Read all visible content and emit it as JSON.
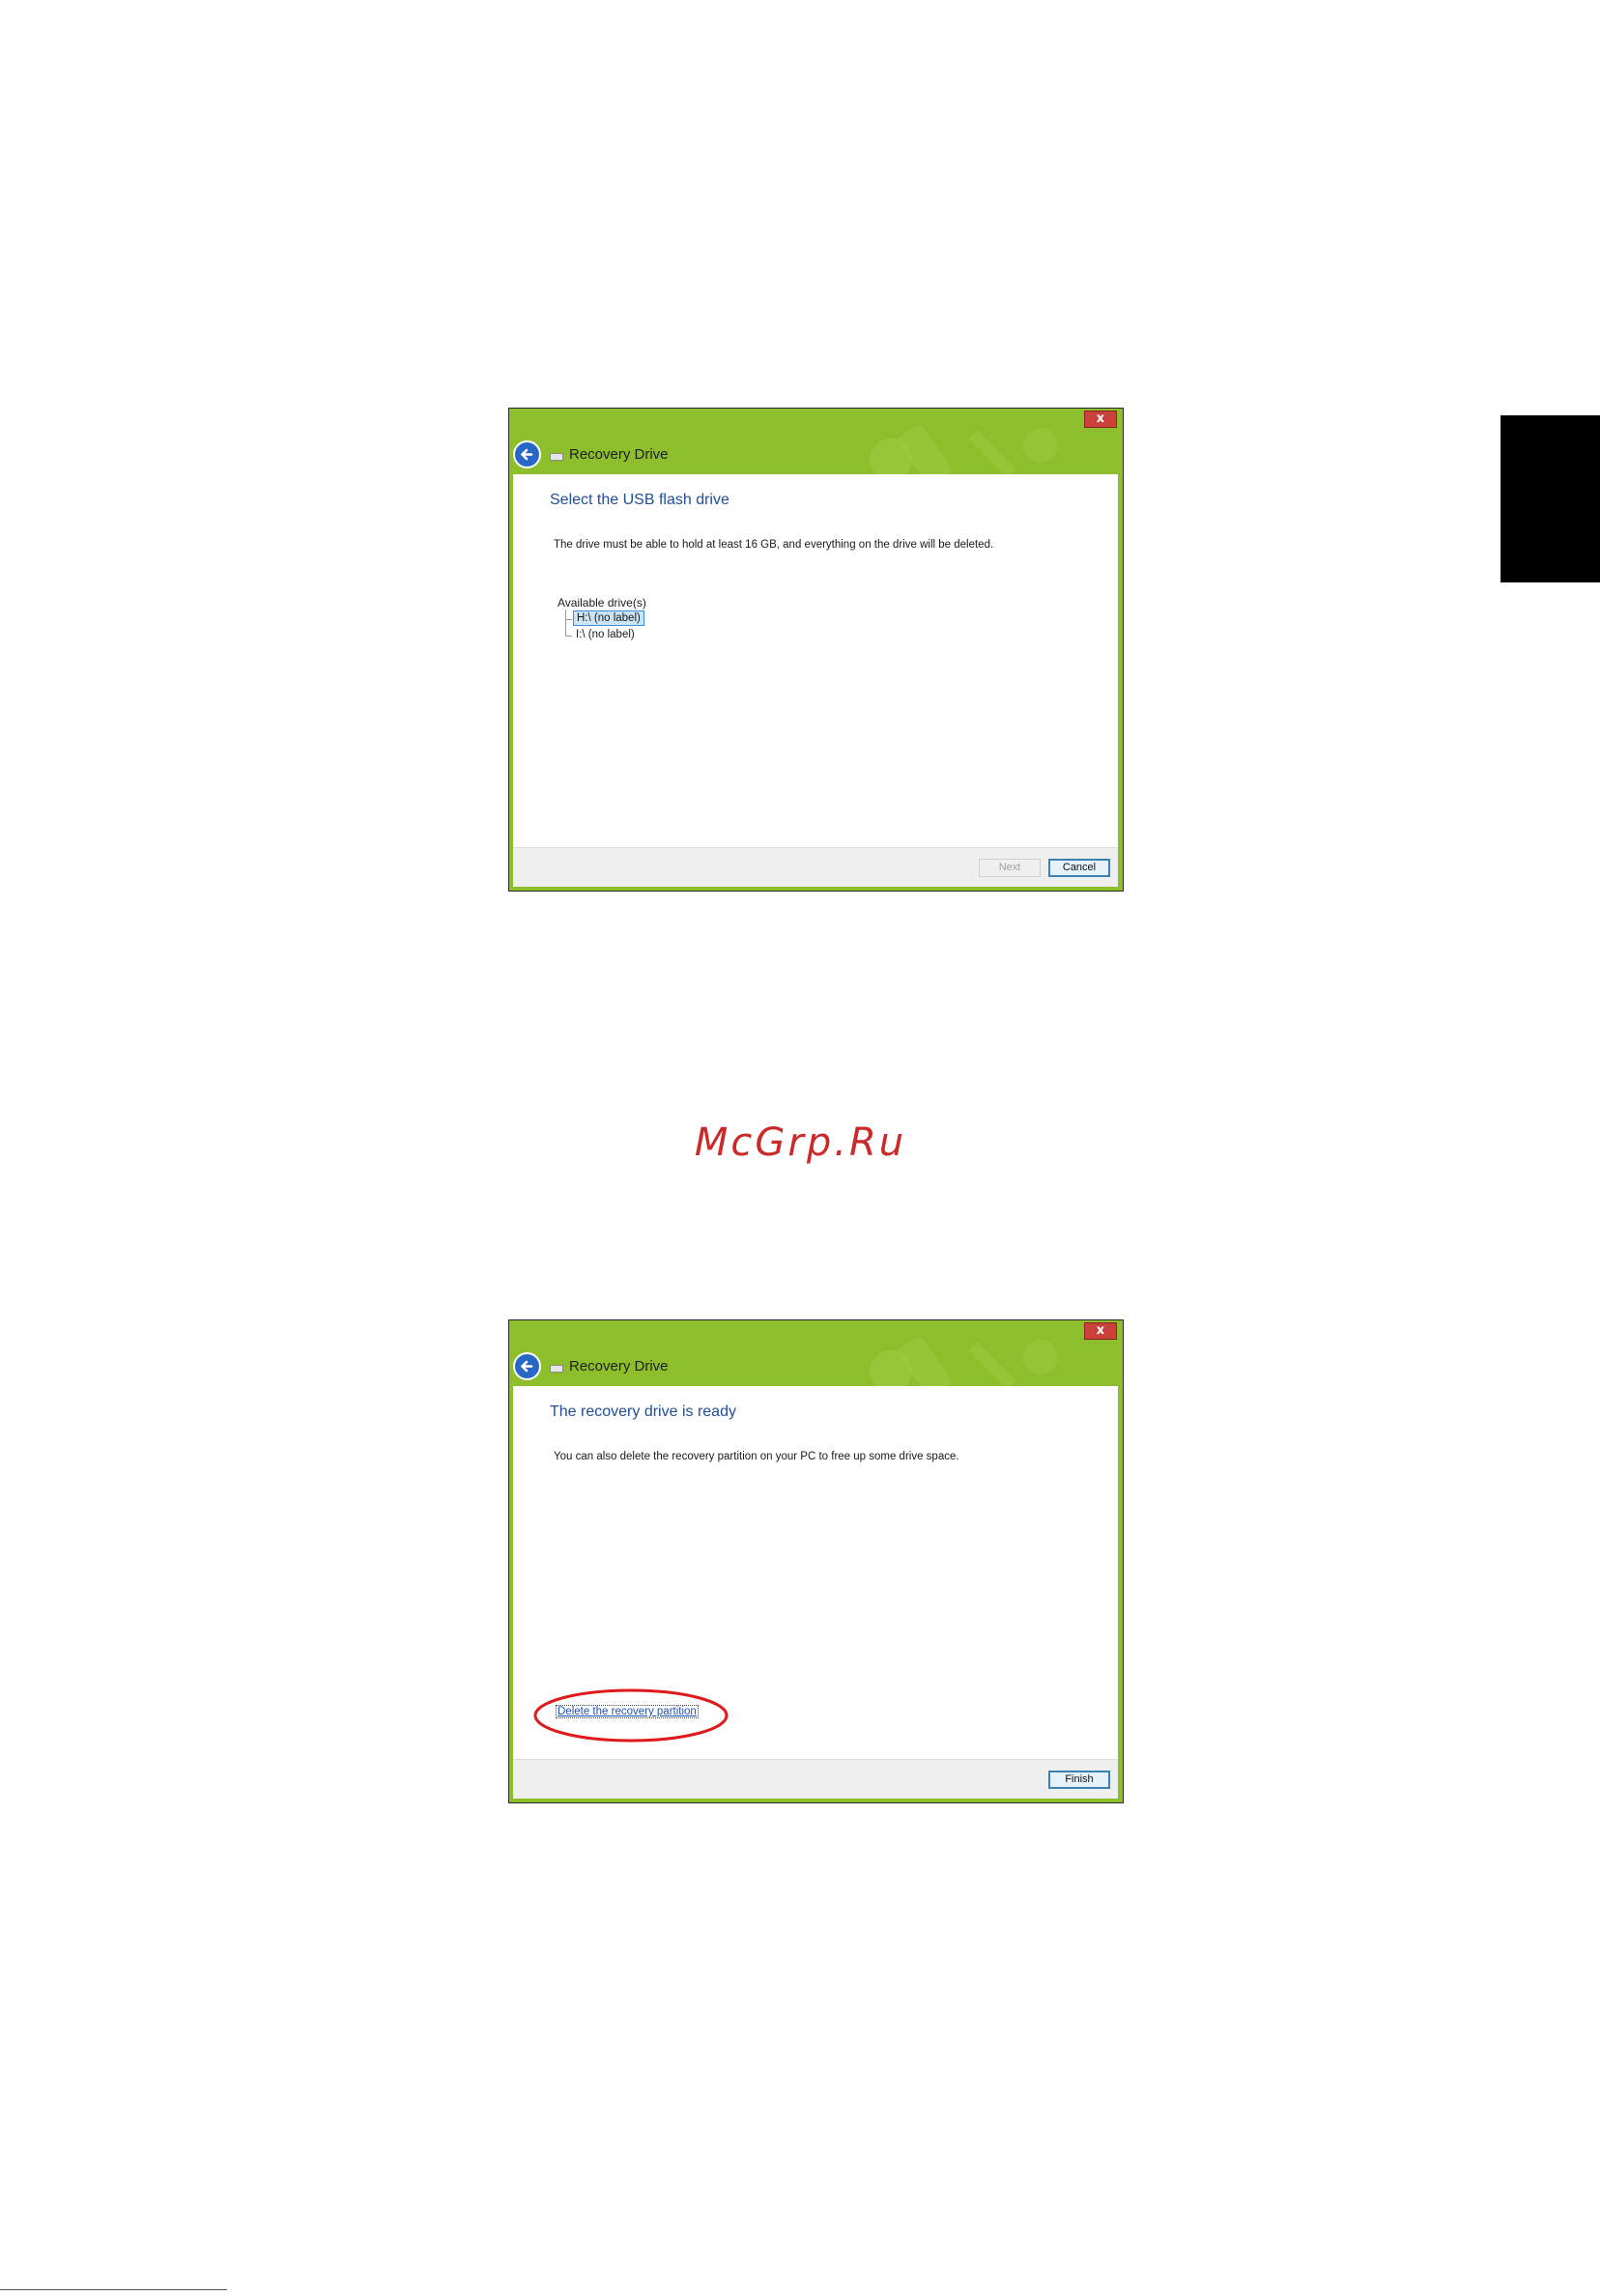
{
  "watermark": "McGrp.Ru",
  "dialog1": {
    "close_label": "x",
    "title": "Recovery Drive",
    "heading": "Select the USB flash drive",
    "description": "The drive must be able to hold at least 16 GB, and everything on the drive will be deleted.",
    "drives_label": "Available drive(s)",
    "drives": [
      {
        "label": "H:\\ (no label)",
        "selected": true
      },
      {
        "label": "I:\\ (no label)",
        "selected": false
      }
    ],
    "buttons": {
      "next": "Next",
      "cancel": "Cancel"
    }
  },
  "dialog2": {
    "close_label": "x",
    "title": "Recovery Drive",
    "heading": "The recovery drive is ready",
    "description": "You can also delete the recovery partition on your PC to free up some drive space.",
    "delete_link": "Delete the recovery partition",
    "buttons": {
      "finish": "Finish"
    }
  },
  "colors": {
    "window_green": "#8dbf2c",
    "heading_blue": "#1e4e9c",
    "close_red": "#c9413a",
    "highlight_red": "#e01a1a"
  }
}
